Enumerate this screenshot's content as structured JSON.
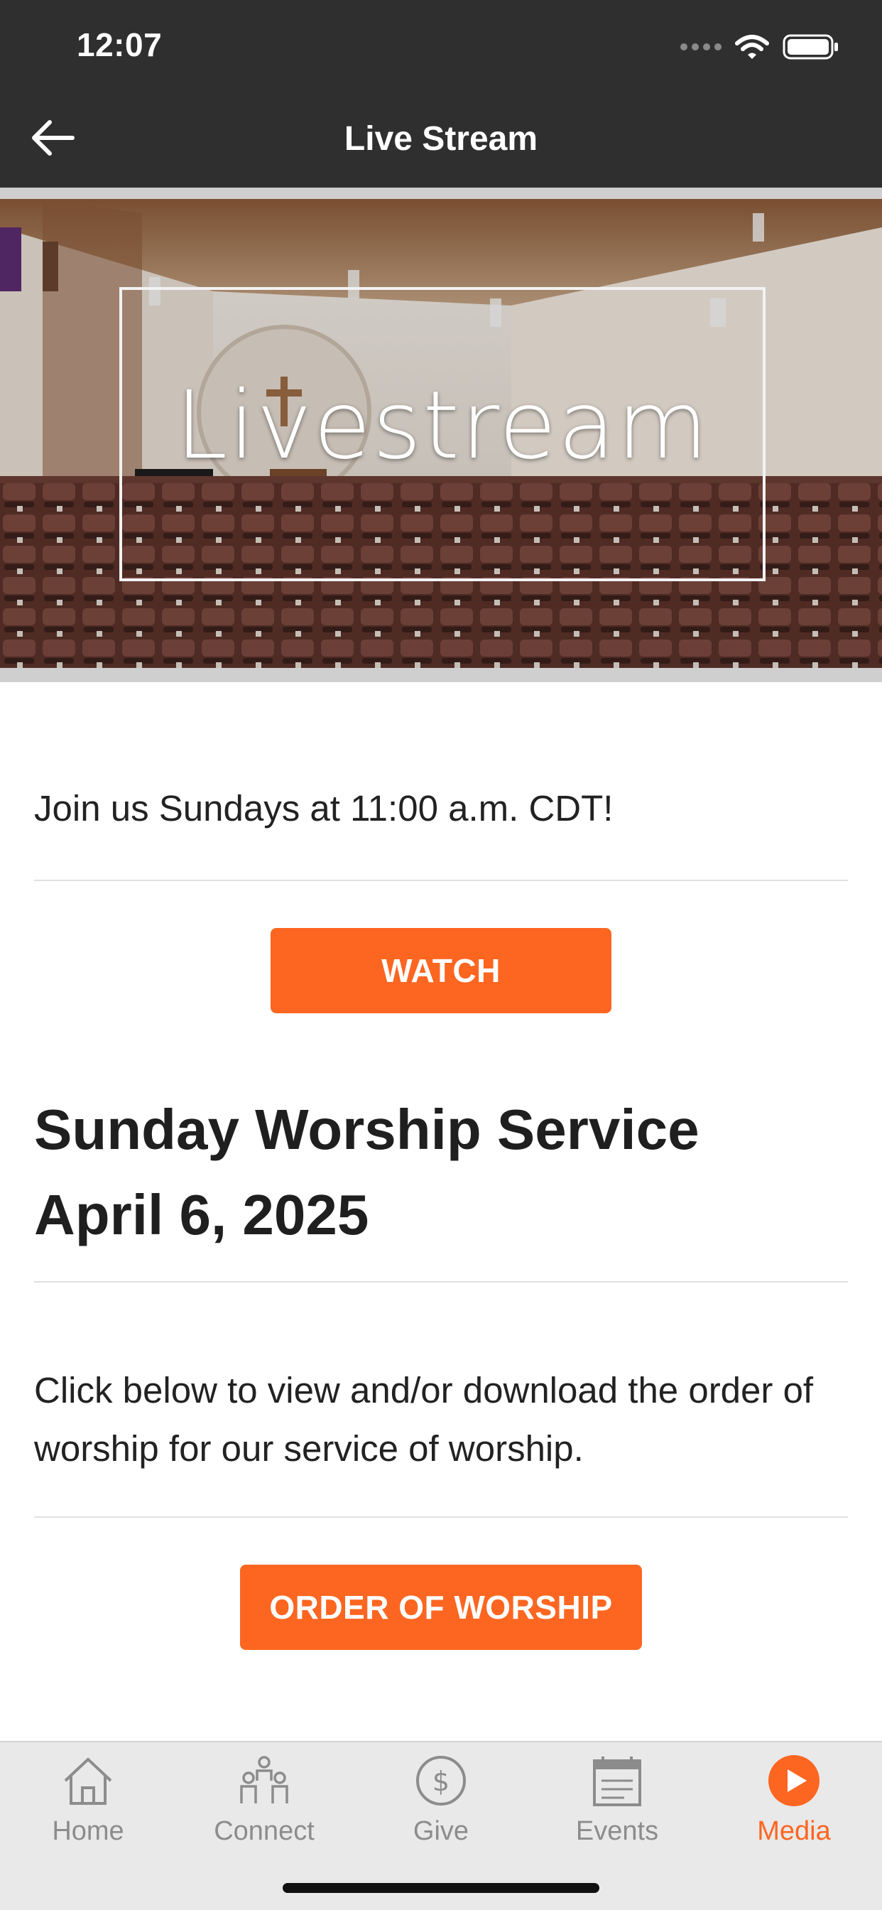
{
  "status_bar": {
    "time": "12:07"
  },
  "nav": {
    "title": "Live Stream",
    "back_icon": "arrow-left-icon"
  },
  "hero": {
    "overlay_text": "Livestream"
  },
  "intro_text": "Join us Sundays at 11:00 a.m. CDT!",
  "watch_button": {
    "label": "WATCH"
  },
  "service": {
    "title_line1": "Sunday Worship Service",
    "title_line2": "April 6, 2025"
  },
  "order_text": "Click below to view and/or download the order of worship for our service of worship.",
  "order_button": {
    "label": "ORDER OF WORSHIP"
  },
  "tabs": [
    {
      "label": "Home",
      "icon": "house-icon",
      "active": false
    },
    {
      "label": "Connect",
      "icon": "people-icon",
      "active": false
    },
    {
      "label": "Give",
      "icon": "dollar-icon",
      "active": false
    },
    {
      "label": "Events",
      "icon": "calendar-icon",
      "active": false
    },
    {
      "label": "Media",
      "icon": "play-icon",
      "active": true
    }
  ],
  "colors": {
    "accent": "#fd6621",
    "topbar": "#2f2f2f",
    "tab_inactive": "#8c8c8c",
    "tabbar_bg": "#e9e9e9"
  }
}
